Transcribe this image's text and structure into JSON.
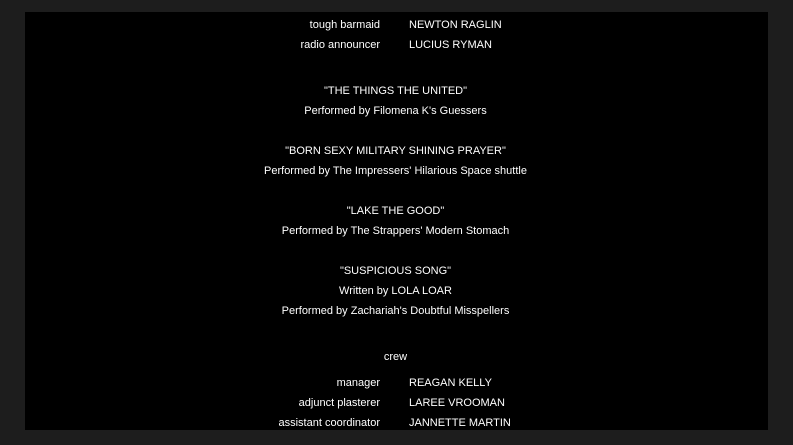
{
  "credits": {
    "cast_rows": [
      {
        "role": "tough barmaid",
        "name": "NEWTON RAGLIN"
      },
      {
        "role": "radio announcer",
        "name": "LUCIUS RYMAN"
      }
    ],
    "songs": [
      {
        "title": "\"THE THINGS THE UNITED\"",
        "lines": [
          "Performed by Filomena K's Guessers"
        ]
      },
      {
        "title": "\"BORN SEXY MILITARY SHINING PRAYER\"",
        "lines": [
          "Performed by The Impressers' Hilarious Space shuttle"
        ]
      },
      {
        "title": "\"LAKE THE GOOD\"",
        "lines": [
          "Performed by The Strappers' Modern Stomach"
        ]
      },
      {
        "title": "\"SUSPICIOUS SONG\"",
        "lines": [
          "Written by LOLA LOAR",
          "Performed by Zachariah's Doubtful Misspellers"
        ]
      }
    ],
    "crew_heading": "crew",
    "crew_rows": [
      {
        "role": "manager",
        "name": "REAGAN KELLY"
      },
      {
        "role": "adjunct plasterer",
        "name": "LAREE VROOMAN"
      },
      {
        "role": "assistant coordinator",
        "name": "JANNETTE MARTIN"
      }
    ]
  },
  "colors": {
    "page_background": "#1d1d1d",
    "video_background": "#000000",
    "text": "#ffffff"
  }
}
